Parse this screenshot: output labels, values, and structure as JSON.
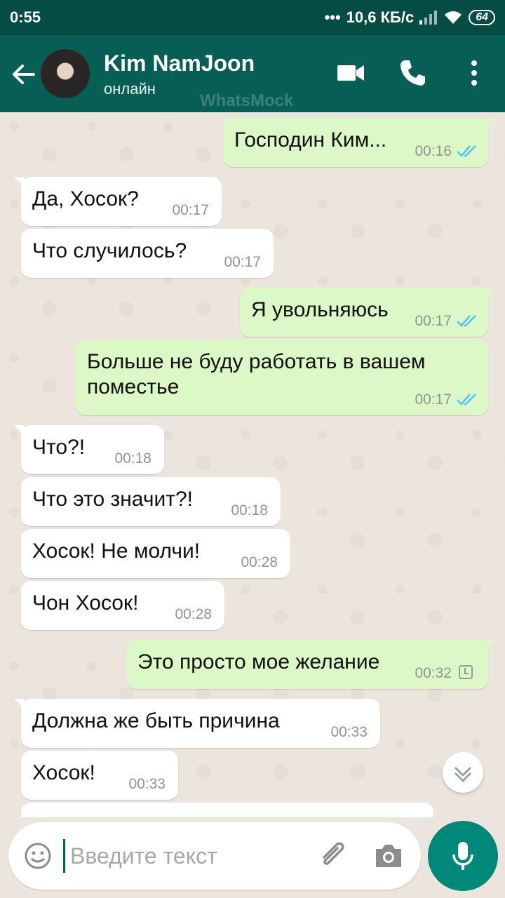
{
  "status_bar": {
    "time": "0:55",
    "network_speed": "10,6 КБ/с",
    "battery": "64"
  },
  "header": {
    "contact_name": "Kim NamJoon",
    "contact_status": "онлайн",
    "watermark": "WhatsMock"
  },
  "messages": [
    {
      "dir": "out",
      "text": "Господин Ким...",
      "time": "00:16",
      "status": "read"
    },
    {
      "dir": "in",
      "text": "Да, Хосок?",
      "time": "00:17"
    },
    {
      "dir": "in",
      "text": "Что случилось?",
      "time": "00:17"
    },
    {
      "dir": "out",
      "text": "Я увольняюсь",
      "time": "00:17",
      "status": "read"
    },
    {
      "dir": "out",
      "text": "Больше не буду работать в вашем поместье",
      "time": "00:17",
      "status": "read"
    },
    {
      "dir": "in",
      "text": "Что?!",
      "time": "00:18"
    },
    {
      "dir": "in",
      "text": "Что это значит?!",
      "time": "00:18"
    },
    {
      "dir": "in",
      "text": "Хосок! Не молчи!",
      "time": "00:28"
    },
    {
      "dir": "in",
      "text": "Чон Хосок!",
      "time": "00:28"
    },
    {
      "dir": "out",
      "text": "Это просто мое желание",
      "time": "00:32",
      "status": "pending"
    },
    {
      "dir": "in",
      "text": "Должна же быть причина",
      "time": "00:33"
    },
    {
      "dir": "in",
      "text": "Хосок!",
      "time": "00:33"
    }
  ],
  "input": {
    "placeholder": "Введите текст",
    "value": ""
  },
  "colors": {
    "header": "#075e54",
    "status_bar": "#054d44",
    "outgoing_bubble": "#dcf8c6",
    "incoming_bubble": "#ffffff",
    "read_check": "#4fc3f7",
    "mic_button": "#00897b"
  },
  "icons": [
    "back-arrow-icon",
    "video-call-icon",
    "phone-icon",
    "more-vert-icon",
    "double-check-icon",
    "clock-icon",
    "chevron-down-icon",
    "emoji-icon",
    "paperclip-icon",
    "camera-icon",
    "mic-icon"
  ]
}
